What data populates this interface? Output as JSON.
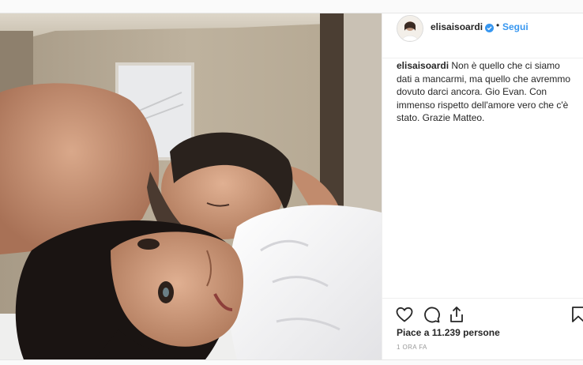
{
  "post": {
    "username": "elisaisoardi",
    "follow_label": "Segui",
    "separator": "•",
    "caption": "Non è quello che ci siamo dati a mancarmi, ma quello che avremmo dovuto darci ancora. Gio Evan. Con immenso rispetto dell'amore vero che c'è stato. Grazie Matteo.",
    "likes": "Piace a 11.239 persone",
    "time": "1 ORA FA"
  },
  "icons": {
    "like": "heart-icon",
    "comment": "comment-icon",
    "share": "share-icon",
    "save": "bookmark-icon",
    "verified": "verified-badge-icon"
  },
  "colors": {
    "accent": "#3897f0",
    "text": "#262626",
    "muted": "#999999"
  }
}
